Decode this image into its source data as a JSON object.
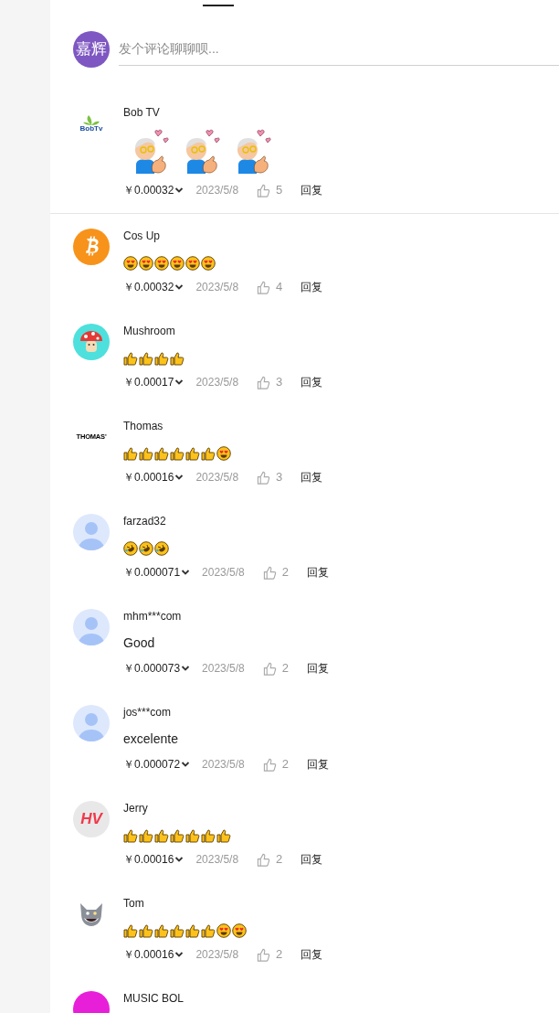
{
  "composer": {
    "avatar": {
      "kind": "text",
      "text": "嘉辉",
      "color": "#7e57c2"
    },
    "placeholder": "发个评论聊聊呗..."
  },
  "comments": [
    {
      "name": "Bob TV",
      "avatar": {
        "kind": "logo",
        "text": "BobTv"
      },
      "content": [
        {
          "kind": "sticker"
        },
        {
          "kind": "sticker"
        },
        {
          "kind": "sticker"
        }
      ],
      "price": "￥0.00032",
      "date": "2023/5/8",
      "likes": "5",
      "reply": "回复",
      "divider": true
    },
    {
      "name": "Cos Up",
      "avatar": {
        "kind": "bitcoin",
        "color": "#f7931a"
      },
      "content": [
        {
          "kind": "heart-eyes"
        },
        {
          "kind": "heart-eyes"
        },
        {
          "kind": "heart-eyes"
        },
        {
          "kind": "heart-eyes"
        },
        {
          "kind": "heart-eyes"
        },
        {
          "kind": "heart-eyes"
        }
      ],
      "price": "￥0.00032",
      "date": "2023/5/8",
      "likes": "4",
      "reply": "回复",
      "divider": false
    },
    {
      "name": "Mushroom",
      "avatar": {
        "kind": "mushroom",
        "color": "#4ee0dc"
      },
      "content": [
        {
          "kind": "thumbs-up"
        },
        {
          "kind": "thumbs-up"
        },
        {
          "kind": "thumbs-up"
        },
        {
          "kind": "thumbs-up"
        }
      ],
      "price": "￥0.00017",
      "date": "2023/5/8",
      "likes": "3",
      "reply": "回复",
      "divider": false
    },
    {
      "name": "Thomas",
      "avatar": {
        "kind": "wordmark",
        "text": "THOMAS'"
      },
      "content": [
        {
          "kind": "thumbs-up"
        },
        {
          "kind": "thumbs-up"
        },
        {
          "kind": "thumbs-up"
        },
        {
          "kind": "thumbs-up"
        },
        {
          "kind": "thumbs-up"
        },
        {
          "kind": "thumbs-up"
        },
        {
          "kind": "heart-eyes"
        }
      ],
      "price": "￥0.00016",
      "date": "2023/5/8",
      "likes": "3",
      "reply": "回复",
      "divider": false
    },
    {
      "name": "farzad32",
      "avatar": {
        "kind": "default"
      },
      "content": [
        {
          "kind": "rofl"
        },
        {
          "kind": "rofl"
        },
        {
          "kind": "rofl"
        }
      ],
      "price": "￥0.000071",
      "date": "2023/5/8",
      "likes": "2",
      "reply": "回复",
      "divider": false
    },
    {
      "name": "mhm***com",
      "avatar": {
        "kind": "default"
      },
      "text": "Good",
      "price": "￥0.000073",
      "date": "2023/5/8",
      "likes": "2",
      "reply": "回复",
      "divider": false
    },
    {
      "name": "jos***com",
      "avatar": {
        "kind": "default"
      },
      "text": "excelente",
      "price": "￥0.000072",
      "date": "2023/5/8",
      "likes": "2",
      "reply": "回复",
      "divider": false
    },
    {
      "name": "Jerry",
      "avatar": {
        "kind": "initials",
        "text": "HV",
        "color": "#e8e8e8"
      },
      "content": [
        {
          "kind": "thumbs-up"
        },
        {
          "kind": "thumbs-up"
        },
        {
          "kind": "thumbs-up"
        },
        {
          "kind": "thumbs-up"
        },
        {
          "kind": "thumbs-up"
        },
        {
          "kind": "thumbs-up"
        },
        {
          "kind": "thumbs-up"
        }
      ],
      "price": "￥0.00016",
      "date": "2023/5/8",
      "likes": "2",
      "reply": "回复",
      "divider": false
    },
    {
      "name": "Tom",
      "avatar": {
        "kind": "cat"
      },
      "content": [
        {
          "kind": "thumbs-up"
        },
        {
          "kind": "thumbs-up"
        },
        {
          "kind": "thumbs-up"
        },
        {
          "kind": "thumbs-up"
        },
        {
          "kind": "thumbs-up"
        },
        {
          "kind": "thumbs-up"
        },
        {
          "kind": "heart-eyes"
        },
        {
          "kind": "heart-eyes"
        }
      ],
      "price": "￥0.00016",
      "date": "2023/5/8",
      "likes": "2",
      "reply": "回复",
      "divider": false
    },
    {
      "name": "MUSIC BOL",
      "avatar": {
        "kind": "photo",
        "color": "#e81fd8"
      },
      "divider": false
    }
  ]
}
